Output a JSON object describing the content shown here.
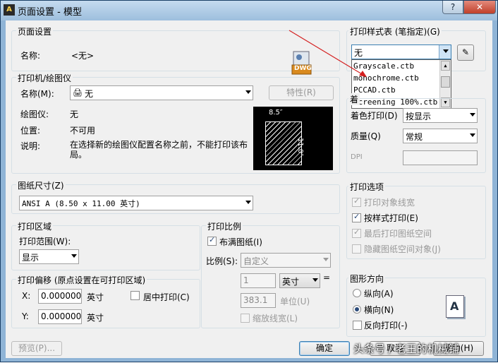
{
  "window": {
    "title": "页面设置 - 模型",
    "help": "?",
    "close": "✕"
  },
  "page_setup": {
    "group": "页面设置",
    "name_label": "名称:",
    "name_value": "<无>",
    "dwg_icon_text": "DWG"
  },
  "printer": {
    "group": "打印机/绘图仪",
    "name_label": "名称(M):",
    "name_value": "无",
    "properties_btn": "特性(R)",
    "plotter_label": "绘图仪:",
    "plotter_value": "无",
    "location_label": "位置:",
    "location_value": "不可用",
    "desc_label": "说明:",
    "desc_value": "在选择新的绘图仪配置名称之前，不能打印该布局。",
    "preview_width": "8.5″",
    "preview_height": "11.0″"
  },
  "paper_size": {
    "group": "图纸尺寸(Z)",
    "value": "ANSI A (8.50 x 11.00 英寸)"
  },
  "plot_area": {
    "group": "打印区域",
    "range_label": "打印范围(W):",
    "range_value": "显示"
  },
  "plot_offset": {
    "group": "打印偏移 (原点设置在可打印区域)",
    "x_label": "X:",
    "x_value": "0.000000",
    "x_unit": "英寸",
    "y_label": "Y:",
    "y_value": "0.000000",
    "y_unit": "英寸",
    "center_label": "居中打印(C)",
    "center_checked": false
  },
  "plot_scale": {
    "group": "打印比例",
    "fit_label": "布满图纸(I)",
    "fit_checked": true,
    "scale_label": "比例(S):",
    "scale_value": "自定义",
    "val1": "1",
    "unit_value": "英寸",
    "equals": "=",
    "val2": "383.1",
    "unit_label": "单位(U)",
    "lineweights_label": "缩放线宽(L)",
    "lineweights_checked": false
  },
  "style_table": {
    "group": "打印样式表 (笔指定)(G)",
    "value": "无",
    "dropdown_options": [
      "Grayscale.ctb",
      "monochrome.ctb",
      "PCCAD.ctb",
      "Screening 100%.ctb"
    ],
    "edit_icon": "edit-pen-icon"
  },
  "viewport": {
    "partial_label": "着",
    "shade_label": "着色打印(D)",
    "shade_value": "按显示",
    "quality_label": "质量(Q)",
    "quality_value": "常规",
    "dpi_label": "DPI"
  },
  "plot_options": {
    "group": "打印选项",
    "lineweights": "打印对象线宽",
    "lineweights_checked": true,
    "styles": "按样式打印(E)",
    "styles_checked": true,
    "paperspace_last": "最后打印图纸空间",
    "paperspace_last_checked": true,
    "hide_objects": "隐藏图纸空间对象(J)",
    "hide_objects_checked": false
  },
  "orientation": {
    "group": "图形方向",
    "portrait": "纵向(A)",
    "landscape": "横向(N)",
    "selected": "landscape",
    "upside_down": "反向打印(-)",
    "upside_down_checked": false,
    "icon_letter": "A"
  },
  "buttons": {
    "preview": "预览(P)...",
    "ok": "确定",
    "cancel": "取消",
    "help": "帮助(H)"
  },
  "watermark": "头条号 / 老王的机械铺",
  "colors": {
    "arrow": "#d42020",
    "title_bar": "#9dbfdd",
    "accent": "#2b4b7a"
  }
}
